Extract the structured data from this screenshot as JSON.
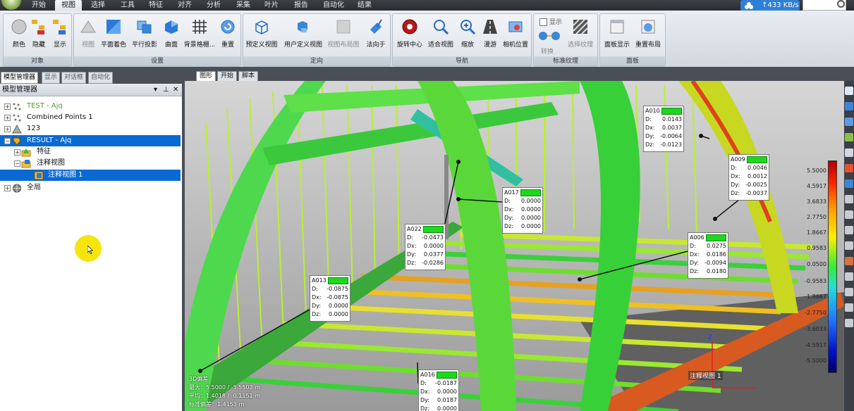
{
  "menu": {
    "tabs": [
      "开始",
      "视图",
      "选择",
      "工具",
      "特征",
      "对齐",
      "分析",
      "采集",
      "叶片",
      "报告",
      "自动化",
      "结果"
    ],
    "active_tab": "视图"
  },
  "network": {
    "speed": "↑433 KB/s"
  },
  "ribbon": {
    "groups": [
      {
        "title": "对象",
        "tools": [
          "颜色",
          "隐藏",
          "显示"
        ]
      },
      {
        "title": "设置",
        "tools": [
          "视图",
          "平面着色",
          "平行投影",
          "曲面",
          "背景格栅...",
          "重置"
        ]
      },
      {
        "title": "定向",
        "tools": [
          "预定义视图",
          "用户定义视图",
          "视图布局图",
          "法向于"
        ]
      },
      {
        "title": "导航",
        "tools": [
          "旋转中心",
          "适合视图",
          "缩放",
          "漫游",
          "相机位置"
        ]
      },
      {
        "title": "标准纹理",
        "tools": [
          "显示",
          "转换",
          "选择纹理"
        ]
      },
      {
        "title": "面板",
        "tools": [
          "面板显示",
          "重置布局"
        ]
      }
    ]
  },
  "panel": {
    "tabs": [
      "模型管理器",
      "显示",
      "对话框",
      "自动化"
    ],
    "active_tab": "模型管理器",
    "title": "模型管理器",
    "tree": [
      {
        "label": "TEST - Ajq",
        "level": 0,
        "icon": "points-icon",
        "dim": true
      },
      {
        "label": "Combined Points 1",
        "level": 0,
        "icon": "points-icon"
      },
      {
        "label": "123",
        "level": 0,
        "icon": "mesh-icon"
      },
      {
        "label": "RESULT - Ajq",
        "level": 0,
        "icon": "result-icon",
        "selected": true
      },
      {
        "label": "特征",
        "level": 1,
        "icon": "feature-folder-icon"
      },
      {
        "label": "注释视图",
        "level": 1,
        "icon": "annotation-folder-icon"
      },
      {
        "label": "注释视图 1",
        "level": 2,
        "icon": "annotation-view-icon",
        "selected": true
      },
      {
        "label": "全局",
        "level": 0,
        "icon": "globe-icon"
      }
    ]
  },
  "viewport": {
    "tabs": [
      "图形",
      "开始",
      "脚本"
    ],
    "active_tab": "图形",
    "annotations": [
      {
        "id": "A010",
        "D": "0.0143",
        "Dx": "0.0037",
        "Dy": "-0.0064",
        "Dz": "-0.0123"
      },
      {
        "id": "A009",
        "D": "0.0046",
        "Dx": "0.0012",
        "Dy": "-0.0025",
        "Dz": "-0.0037"
      },
      {
        "id": "A017",
        "D": "0.0000",
        "Dx": "0.0000",
        "Dy": "0.0000",
        "Dz": "0.0000"
      },
      {
        "id": "A022",
        "D": "-0.0473",
        "Dx": "0.0000",
        "Dy": "0.0377",
        "Dz": "-0.0286"
      },
      {
        "id": "A006",
        "D": "0.0275",
        "Dx": "0.0186",
        "Dy": "-0.0094",
        "Dz": "0.0180"
      },
      {
        "id": "A013",
        "D": "-0.0875",
        "Dx": "-0.0875",
        "Dy": "0.0000",
        "Dz": "0.0000"
      },
      {
        "id": "A016",
        "D": "-0.0187",
        "Dx": "0.0000",
        "Dy": "0.0187",
        "Dz": "0.0000"
      }
    ],
    "keys": {
      "d": "D:",
      "dx": "Dx:",
      "dy": "Dy:",
      "dz": "Dz:"
    },
    "stats": [
      "3D偏差",
      "最大：5.5000 / -5.5503 m",
      "平均：1.4018 / -0.1151 m",
      "标准偏差：1.4153 m"
    ],
    "view_label": "注释视图 1",
    "axis_label": "Z",
    "color_scale": [
      "5.5000",
      "4.5917",
      "3.6833",
      "2.7750",
      "1.8667",
      "0.9583",
      "0.0500",
      "-0.9583",
      "-1.8667",
      "-2.7750",
      "-3.6033",
      "-4.5917",
      "-5.5000"
    ]
  },
  "colors": {
    "accent": "#0a6ad3",
    "badge": "#1ed81e"
  }
}
